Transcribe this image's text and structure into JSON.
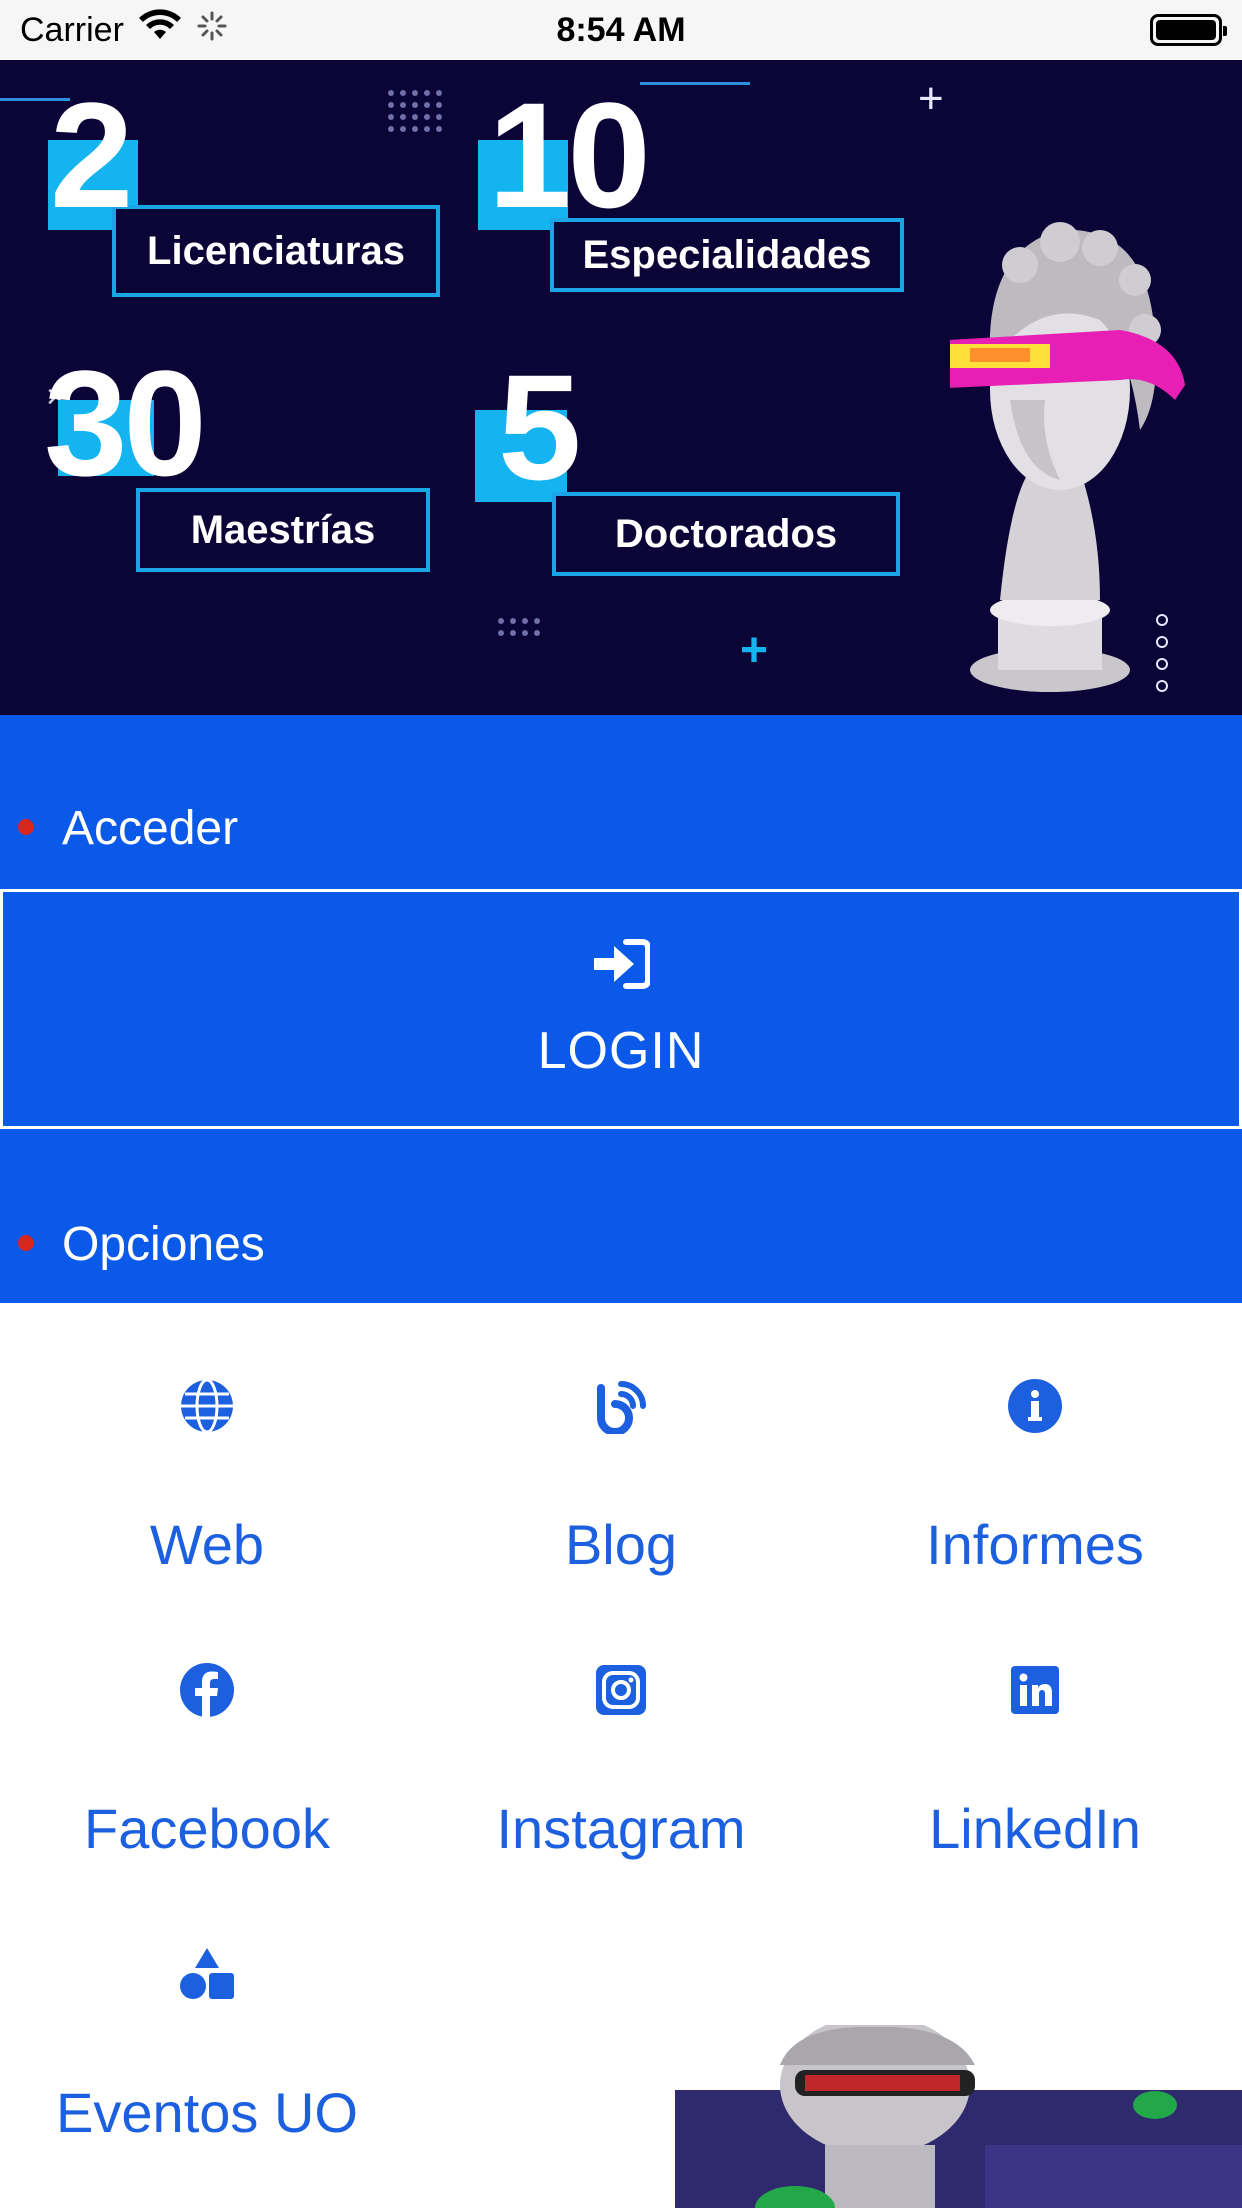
{
  "status_bar": {
    "carrier": "Carrier",
    "time": "8:54 AM"
  },
  "banner": {
    "stats": [
      {
        "number": "2",
        "label": "Licenciaturas"
      },
      {
        "number": "10",
        "label": "Especialidades"
      },
      {
        "number": "30",
        "label": "Maestrías"
      },
      {
        "number": "5",
        "label": "Doctorados"
      }
    ],
    "close_glyph": "×"
  },
  "sections": {
    "access": "Acceder",
    "options": "Opciones"
  },
  "login": {
    "label": "LOGIN"
  },
  "options": [
    {
      "label": "Web",
      "icon": "globe-icon"
    },
    {
      "label": "Blog",
      "icon": "blog-icon"
    },
    {
      "label": "Informes",
      "icon": "info-icon"
    },
    {
      "label": "Facebook",
      "icon": "facebook-icon"
    },
    {
      "label": "Instagram",
      "icon": "instagram-icon"
    },
    {
      "label": "LinkedIn",
      "icon": "linkedin-icon"
    },
    {
      "label": "Eventos UO",
      "icon": "shapes-icon"
    }
  ],
  "colors": {
    "primary_blue": "#0b59e8",
    "banner_navy": "#0b0436",
    "accent_cyan": "#14b4f0",
    "bullet_red": "#d8261e",
    "option_text": "#1c60df"
  }
}
